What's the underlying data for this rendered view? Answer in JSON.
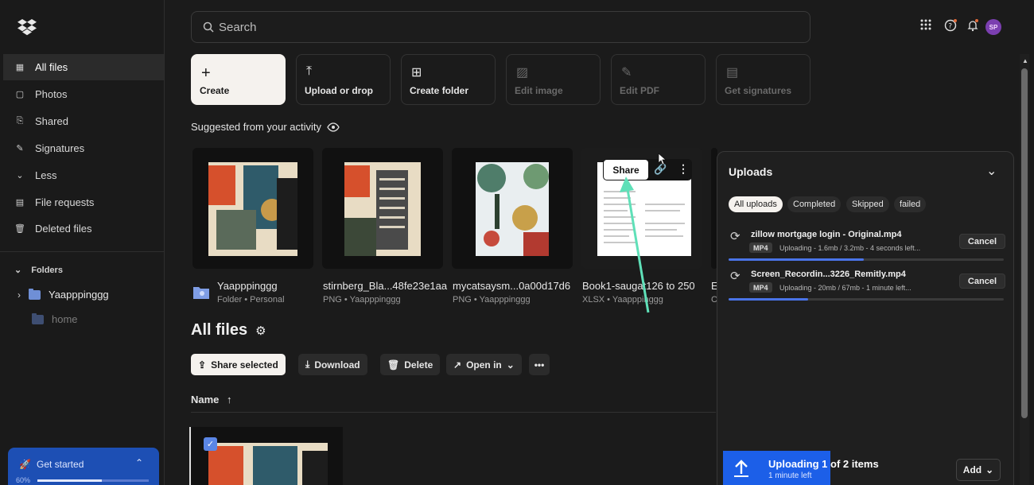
{
  "sidebar": {
    "items": [
      {
        "label": "All files",
        "icon": "all-files-icon"
      },
      {
        "label": "Photos",
        "icon": "photos-icon"
      },
      {
        "label": "Shared",
        "icon": "shared-icon"
      },
      {
        "label": "Signatures",
        "icon": "signatures-icon"
      },
      {
        "label": "Less",
        "icon": "chevron-down-icon"
      },
      {
        "label": "File requests",
        "icon": "file-requests-icon"
      },
      {
        "label": "Deleted files",
        "icon": "trash-icon"
      }
    ],
    "folders_heading": "Folders",
    "folders": [
      {
        "label": "Yaapppinggg"
      },
      {
        "label": "home"
      }
    ],
    "get_started": {
      "label": "Get started",
      "percent_label": "60%",
      "progress": 0.58
    }
  },
  "search": {
    "placeholder": "Search"
  },
  "header": {
    "avatar_initials": "SP"
  },
  "quick_actions": [
    {
      "label": "Create",
      "icon": "plus-icon"
    },
    {
      "label": "Upload or drop",
      "icon": "upload-icon"
    },
    {
      "label": "Create folder",
      "icon": "folder-plus-icon"
    },
    {
      "label": "Edit image",
      "icon": "image-icon"
    },
    {
      "label": "Edit PDF",
      "icon": "pen-icon"
    },
    {
      "label": "Get signatures",
      "icon": "signature-doc-icon"
    }
  ],
  "suggested": {
    "heading": "Suggested from your activity",
    "items": [
      {
        "title": "Yaapppinggg",
        "subtitle": "Folder • Personal"
      },
      {
        "title": "stirnberg_Bla...48fe23e1aa",
        "subtitle": "PNG • Yaapppinggg"
      },
      {
        "title": "mycatsaysm...0a00d17d6",
        "subtitle": "PNG • Yaapppinggg"
      },
      {
        "title": "Book1-saugat126 to 250",
        "subtitle": "XLSX • Yaapppinggg"
      },
      {
        "title": "E",
        "subtitle": "C"
      }
    ],
    "share_label": "Share"
  },
  "all_files": {
    "title": "All files",
    "actions": [
      "Share selected",
      "Download",
      "Delete",
      "Open in"
    ],
    "name_column": "Name"
  },
  "uploads": {
    "title": "Uploads",
    "filters": [
      "All uploads",
      "Completed",
      "Skipped",
      "failed"
    ],
    "items": [
      {
        "name": "zillow mortgage login - Original.mp4",
        "type": "MP4",
        "status": "Uploading - 1.6mb / 3.2mb - 4 seconds left...",
        "cancel": "Cancel",
        "progress": 0.5
      },
      {
        "name": "Screen_Recordin...3226_Remitly.mp4",
        "type": "MP4",
        "status": "Uploading - 20mb / 67mb - 1 minute left...",
        "cancel": "Cancel",
        "progress": 0.3
      }
    ],
    "footer_title": "Uploading 1 of 2 items",
    "footer_sub": "1 minute left",
    "add_label": "Add"
  }
}
